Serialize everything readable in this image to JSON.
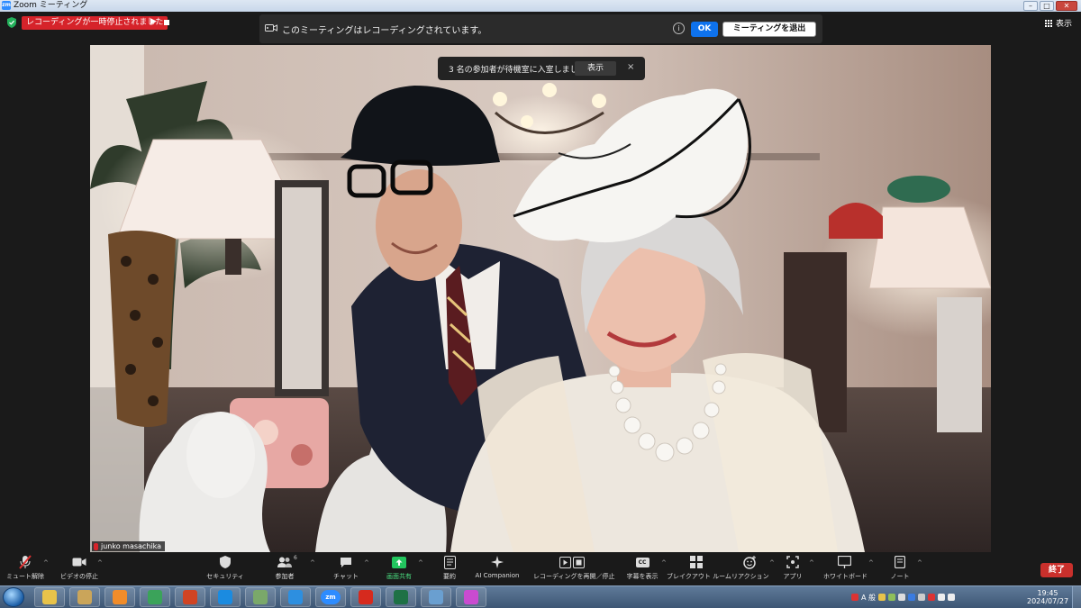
{
  "window": {
    "title": "Zoom ミーティング",
    "logo_text": "zm"
  },
  "recording": {
    "status": "レコーディングが一時停止されました",
    "banner_message": "このミーティングはレコーディングされています。",
    "info_icon": "i",
    "ok_label": "OK",
    "leave_label": "ミーティングを退出"
  },
  "view": {
    "label": "表示"
  },
  "waiting_toast": {
    "message": "3 名の参加者が待機室に入室しました",
    "show_label": "表示",
    "close_glyph": "×"
  },
  "participant": {
    "name": "junko masachika"
  },
  "toolbar": {
    "items": [
      {
        "label": "ミュート解除",
        "icon": "mic-muted-icon"
      },
      {
        "label": "ビデオの停止",
        "icon": "video-icon"
      },
      {
        "label": "セキュリティ",
        "icon": "shield-icon"
      },
      {
        "label": "参加者",
        "icon": "participants-icon",
        "count": "6"
      },
      {
        "label": "チャット",
        "icon": "chat-icon"
      },
      {
        "label": "画面共有",
        "icon": "share-screen-icon",
        "color": "#22c55e"
      },
      {
        "label": "要約",
        "icon": "summary-icon"
      },
      {
        "label": "AI Companion",
        "icon": "ai-companion-icon"
      },
      {
        "label": "レコーディングを再開／停止",
        "icon": "record-resume-stop-icon"
      },
      {
        "label": "字幕を表示",
        "icon": "captions-icon",
        "icon_text": "CC"
      },
      {
        "label": "ブレイクアウト ルーム",
        "icon": "breakout-rooms-icon"
      },
      {
        "label": "リアクション",
        "icon": "reactions-icon"
      },
      {
        "label": "アプリ",
        "icon": "apps-icon"
      },
      {
        "label": "ホワイトボード",
        "icon": "whiteboard-icon"
      },
      {
        "label": "ノート",
        "icon": "notes-icon"
      }
    ],
    "end_label": "終了"
  },
  "taskbar": {
    "apps": [
      {
        "name": "explorer",
        "color": "#e8c34a"
      },
      {
        "name": "folder",
        "color": "#caa55a"
      },
      {
        "name": "media",
        "color": "#f08c2a"
      },
      {
        "name": "chrome",
        "color": "#3ba35a"
      },
      {
        "name": "powerpoint",
        "color": "#d04423"
      },
      {
        "name": "edge",
        "color": "#1b8be0"
      },
      {
        "name": "mail",
        "color": "#7aa86a"
      },
      {
        "name": "ie",
        "color": "#2d8fe0"
      },
      {
        "name": "zoom",
        "color": "#2d8cff",
        "text": "zm"
      },
      {
        "name": "acrobat",
        "color": "#d62a1e"
      },
      {
        "name": "excel",
        "color": "#1e7145"
      },
      {
        "name": "photos",
        "color": "#6a9fd0"
      },
      {
        "name": "color-app",
        "color": "#c94bd0"
      }
    ],
    "tray_text": "A 般",
    "time": "19:45",
    "date": "2024/07/27"
  },
  "colors": {
    "accent": "#0e72ed",
    "record_red": "#d6232a",
    "end_red": "#c9302c",
    "background": "#1a1a1a"
  }
}
